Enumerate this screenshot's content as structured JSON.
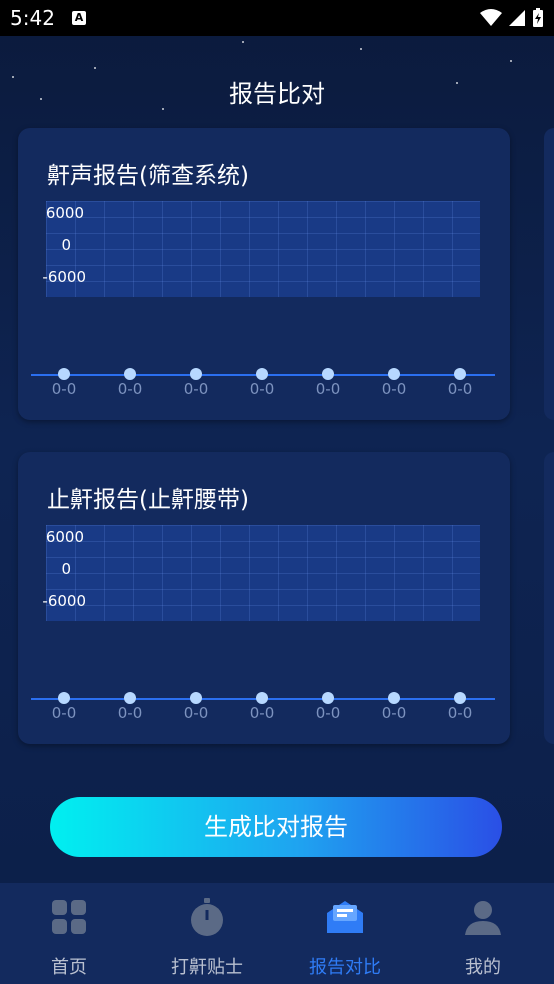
{
  "status_bar": {
    "time": "5:42",
    "a_icon": "A"
  },
  "page": {
    "title": "报告比对"
  },
  "cards": [
    {
      "title": "鼾声报告(筛查系统)",
      "y_ticks": [
        "6000",
        "0",
        "-6000"
      ],
      "x_labels": [
        "0-0",
        "0-0",
        "0-0",
        "0-0",
        "0-0",
        "0-0",
        "0-0"
      ]
    },
    {
      "title": "止鼾报告(止鼾腰带)",
      "y_ticks": [
        "6000",
        "0",
        "-6000"
      ],
      "x_labels": [
        "0-0",
        "0-0",
        "0-0",
        "0-0",
        "0-0",
        "0-0",
        "0-0"
      ]
    }
  ],
  "generate_button": {
    "label": "生成比对报告"
  },
  "tabbar": {
    "items": [
      {
        "label": "首页",
        "icon": "grid-icon"
      },
      {
        "label": "打鼾贴士",
        "icon": "stopwatch-icon"
      },
      {
        "label": "报告对比",
        "icon": "message-icon",
        "active": true
      },
      {
        "label": "我的",
        "icon": "person-icon"
      }
    ]
  },
  "colors": {
    "accent": "#2f7cf6",
    "card": "#132a5e",
    "background": "#0d1f44"
  }
}
